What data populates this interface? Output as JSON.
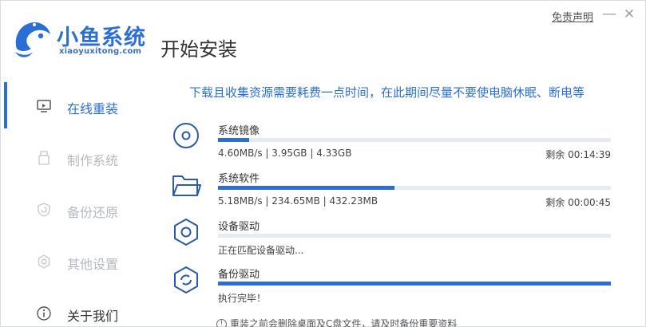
{
  "app": {
    "brand_name": "小鱼系统",
    "brand_url": "xiaoyuxitong.com",
    "page_title": "开始安装",
    "disclaimer": "免责声明",
    "minimize": "—",
    "close": "✕"
  },
  "sidebar": {
    "items": [
      {
        "label": "在线重装",
        "icon": "monitor-icon",
        "state": "active"
      },
      {
        "label": "制作系统",
        "icon": "usb-drive-icon",
        "state": "disabled"
      },
      {
        "label": "备份还原",
        "icon": "restore-icon",
        "state": "disabled"
      },
      {
        "label": "其他设置",
        "icon": "settings-icon",
        "state": "disabled"
      },
      {
        "label": "关于我们",
        "icon": "info-icon",
        "state": "normal"
      }
    ]
  },
  "main": {
    "notice": "下载且收集资源需要耗费一点时间，在此期间尽量不要使电脑休眠、断电等",
    "tasks": [
      {
        "name": "系统镜像",
        "status": "4.60MB/s | 3.95GB | 4.33GB",
        "remaining": "剩余 00:14:39",
        "progress": 0.08,
        "icon": "disc-icon"
      },
      {
        "name": "系统软件",
        "status": "5.18MB/s | 234.65MB | 432.23MB",
        "remaining": "剩余 00:00:45",
        "progress": 0.45,
        "icon": "folder-icon"
      },
      {
        "name": "设备驱动",
        "status": "正在匹配设备驱动...",
        "remaining": "",
        "progress": 0.0,
        "icon": "gear-icon"
      },
      {
        "name": "备份驱动",
        "status": "执行完毕！",
        "remaining": "",
        "progress": 1.0,
        "icon": "gear-sync-icon"
      }
    ],
    "footer_note": "重装之前会删除桌面及C盘文件，请及时备份重要资料"
  },
  "colors": {
    "accent": "#2b6fd6",
    "track": "#e6ebf3",
    "disabled": "#b5b9bf"
  }
}
